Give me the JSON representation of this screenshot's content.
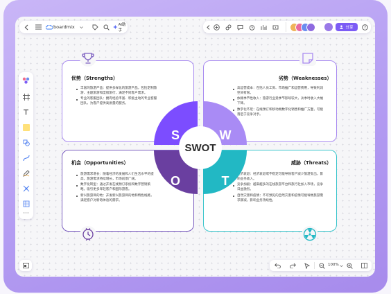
{
  "app": {
    "name": "boardmix",
    "ai_label": "AI助手",
    "share_label": "分享"
  },
  "zoom": "100%",
  "center": {
    "label": "SWOT"
  },
  "quadrant_letters": {
    "s": "S",
    "w": "W",
    "o": "O",
    "t": "T"
  },
  "strengths": {
    "title": "优势（Strengths）",
    "items": [
      "丰富的旅游产品：提供多样化的旅游产品，包括定制旅游、主题旅游和度假旅行，满足不同客户需求。",
      "专业的客服团队：拥有经验丰富、积极主动的专业客服团队，为客户提供高质量的服务。"
    ]
  },
  "weaknesses": {
    "title": "劣势（Weaknesses）",
    "items": [
      "高运营成本：包括人员工资、市场推广和运营费用，导致利润空间有限。",
      "依赖季节性收入：旅游行业受季节影响较大，淡季时收入大幅下降。",
      "数字化不足：在线预订和移动端数字化销售和推广方面，可能落后于竞争对手。"
    ]
  },
  "opportunities": {
    "title": "机会（Opportunities）",
    "items": [
      "旅游需求增长：随着经济的发展和人们生活水平的提高，旅游需求持续增长，市场前景广阔。",
      "数字化转型：通过开发在线预订系统和数字营销策略，吸引更多年轻客户和国际游客。",
      "新兴旅游目的地：开发新兴旅游目的地和特色线路，满足客户对新奇体验的需求。"
    ]
  },
  "threats": {
    "title": "威胁（Threats）",
    "items": [
      "经济衰退：经济衰退或不稳定可能导致客户减少旅游支出，影响业务收入。",
      "竞争加剧：越来越多的在线旅游平台和旅行社加入市场，竞争日益激烈。",
      "自然灾害和疫情：不可预见的自然灾害和疫情可能导致旅游需求骤减，影响业务持续性。"
    ]
  },
  "colors": {
    "s": "#7c4dff",
    "w": "#a98bf5",
    "o": "#6a3fa0",
    "t": "#22b8c4",
    "card_border_purple": "#a98bf0",
    "card_border_teal": "#3cc6cc",
    "accent": "#7c5cf5"
  },
  "icons": {
    "back": "chevron-left-icon",
    "menu": "hamburger-icon",
    "tag": "tag-icon",
    "search": "search-icon",
    "cursor": "cursor-icon",
    "frame": "frame-icon",
    "text": "text-icon",
    "sticky": "sticky-note-icon",
    "shapes": "shapes-icon",
    "connector": "connector-icon",
    "pen": "pen-icon",
    "mindmap": "mindmap-icon",
    "table": "table-icon",
    "more": "more-icon",
    "trophy": "trophy-icon",
    "note": "note-icon",
    "badge": "badge-icon",
    "hazard": "radiation-icon",
    "undo": "undo-icon",
    "redo": "redo-icon",
    "zoom_out": "zoom-out-icon",
    "zoom_in": "zoom-in-icon",
    "map": "map-icon",
    "help": "help-icon"
  }
}
